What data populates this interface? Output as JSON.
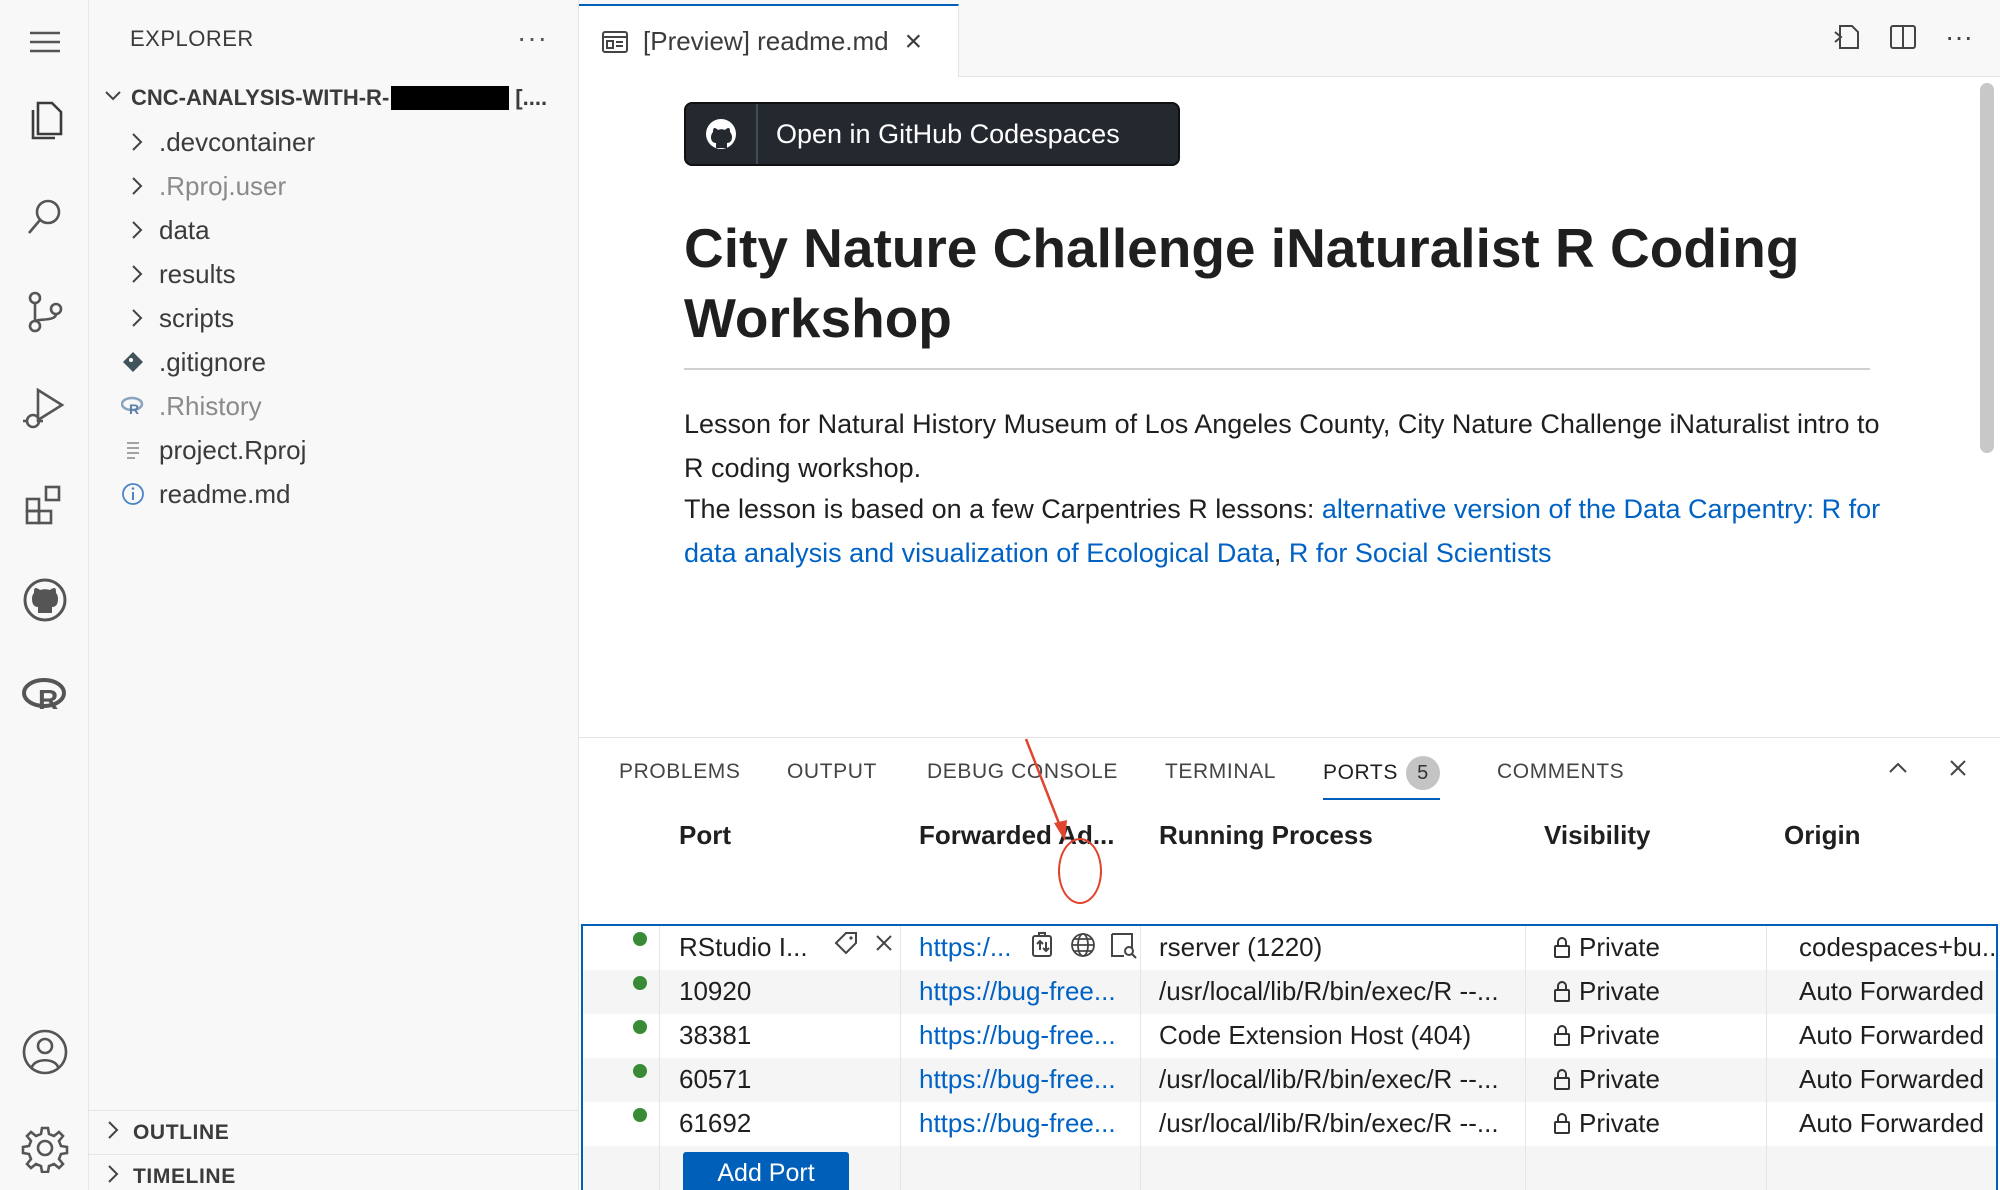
{
  "sidebar": {
    "title": "EXPLORER",
    "more": "···",
    "root": {
      "name": "CNC-ANALYSIS-WITH-R-",
      "suffix": "[...."
    },
    "items": [
      {
        "label": ".devcontainer",
        "type": "folder",
        "dim": false
      },
      {
        "label": ".Rproj.user",
        "type": "folder",
        "dim": true
      },
      {
        "label": "data",
        "type": "folder",
        "dim": false
      },
      {
        "label": "results",
        "type": "folder",
        "dim": false
      },
      {
        "label": "scripts",
        "type": "folder",
        "dim": false
      },
      {
        "label": ".gitignore",
        "type": "git-file",
        "dim": false
      },
      {
        "label": ".Rhistory",
        "type": "r-file",
        "dim": true
      },
      {
        "label": "project.Rproj",
        "type": "text-file",
        "dim": false
      },
      {
        "label": "readme.md",
        "type": "info-file",
        "dim": false
      }
    ],
    "sections": [
      "OUTLINE",
      "TIMELINE"
    ]
  },
  "editor": {
    "tab_title": "[Preview] readme.md",
    "tab_close": "×"
  },
  "preview": {
    "codespaces_button": "Open in GitHub Codespaces",
    "heading": "City Nature Challenge iNaturalist R Coding Workshop",
    "para1": "Lesson for Natural History Museum of Los Angeles County, City Nature Challenge iNaturalist intro to R coding workshop.",
    "para2_prefix": "The lesson is based on a few Carpentries R lessons: ",
    "para2_link1": "alternative version of the Data Carpentry: R for data analysis and visualization of Ecological Data",
    "para2_sep": ", ",
    "para2_link2": "R for Social Scientists"
  },
  "panel": {
    "tabs": [
      "PROBLEMS",
      "OUTPUT",
      "DEBUG CONSOLE",
      "TERMINAL",
      "PORTS",
      "COMMENTS"
    ],
    "ports_badge": "5",
    "columns": [
      "Port",
      "Forwarded Ad...",
      "Running Process",
      "Visibility",
      "Origin"
    ],
    "rows": [
      {
        "port": "RStudio I...",
        "address": "https:/...",
        "process": "rserver (1220)",
        "visibility": "Private",
        "origin": "codespaces+bu..."
      },
      {
        "port": "10920",
        "address": "https://bug-free...",
        "process": "/usr/local/lib/R/bin/exec/R --...",
        "visibility": "Private",
        "origin": "Auto Forwarded"
      },
      {
        "port": "38381",
        "address": "https://bug-free...",
        "process": "Code Extension Host (404)",
        "visibility": "Private",
        "origin": "Auto Forwarded"
      },
      {
        "port": "60571",
        "address": "https://bug-free...",
        "process": "/usr/local/lib/R/bin/exec/R --...",
        "visibility": "Private",
        "origin": "Auto Forwarded"
      },
      {
        "port": "61692",
        "address": "https://bug-free...",
        "process": "/usr/local/lib/R/bin/exec/R --...",
        "visibility": "Private",
        "origin": "Auto Forwarded"
      }
    ],
    "add_port": "Add Port"
  },
  "colors": {
    "accent": "#005fb8",
    "link": "#0062c4",
    "status_green": "#388a34",
    "annotation": "#e0452f"
  }
}
